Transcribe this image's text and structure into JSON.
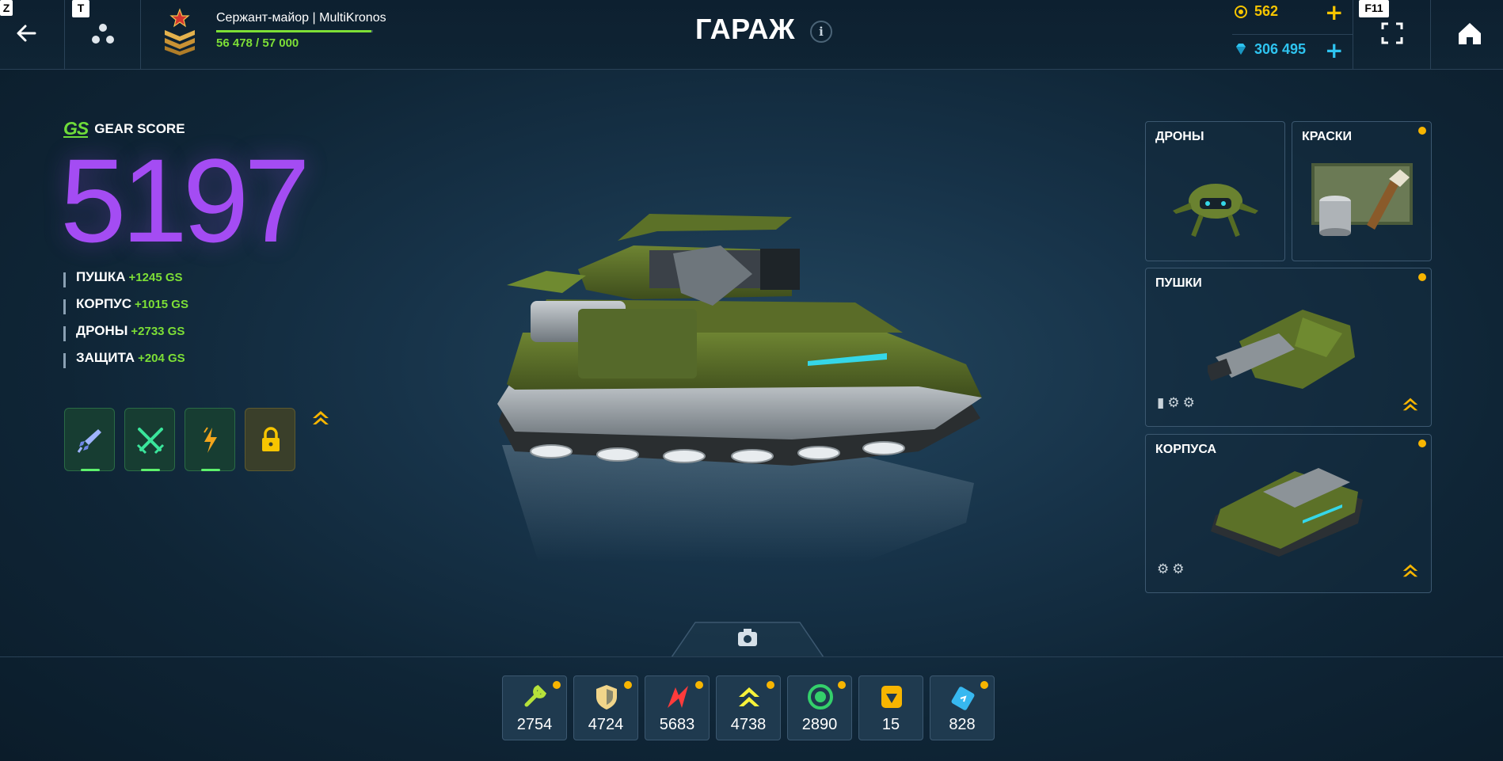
{
  "keys": {
    "z": "Z",
    "t": "T",
    "f11": "F11"
  },
  "header": {
    "title": "ГАРАЖ",
    "info": "i",
    "player": {
      "name": "Сержант-майор | MultiKronos",
      "xp_text": "56 478 / 57 000",
      "xp_progress": 0.9908
    },
    "currency": {
      "crystals": "562",
      "rubies": "306 495",
      "plus": "+"
    }
  },
  "gear_score": {
    "logo": "GS",
    "label": "GEAR SCORE",
    "value": "5197",
    "items": [
      {
        "name": "ПУШКА",
        "bonus": "+1245 GS"
      },
      {
        "name": "КОРПУС",
        "bonus": "+1015 GS"
      },
      {
        "name": "ДРОНЫ",
        "bonus": "+2733 GS"
      },
      {
        "name": "ЗАЩИТА",
        "bonus": "+204 GS"
      }
    ]
  },
  "cards": {
    "drones": {
      "title": "ДРОНЫ"
    },
    "paints": {
      "title": "КРАСКИ"
    },
    "turrets": {
      "title": "ПУШКИ"
    },
    "hulls": {
      "title": "КОРПУСА"
    }
  },
  "inventory": [
    {
      "icon": "repair-kit-icon",
      "count": "2754",
      "color": "#b6e23a"
    },
    {
      "icon": "armor-icon",
      "count": "4724",
      "color": "#f1d58a"
    },
    {
      "icon": "double-damage-icon",
      "count": "5683",
      "color": "#ff3b3b"
    },
    {
      "icon": "speed-boost-icon",
      "count": "4738",
      "color": "#f7f23a"
    },
    {
      "icon": "mine-icon",
      "count": "2890",
      "color": "#34d06b"
    },
    {
      "icon": "gold-box-icon",
      "count": "15",
      "color": "#f7b500"
    },
    {
      "icon": "battery-icon",
      "count": "828",
      "color": "#37b8f0"
    }
  ],
  "colors": {
    "accent_green": "#7ddf36",
    "gear_score_purple": "#a44cf3",
    "notification": "#f7b500",
    "crystal": "#f7c500",
    "ruby": "#2ec4f0"
  }
}
